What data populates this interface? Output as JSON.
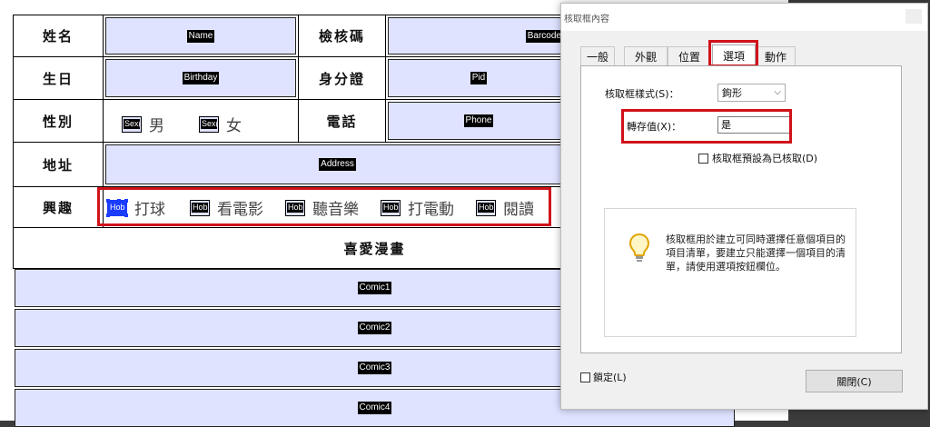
{
  "form": {
    "rows": [
      {
        "label": "姓名",
        "field": "Name",
        "label2": "檢核碼",
        "field2": "Barcode"
      },
      {
        "label": "生日",
        "field": "Birthday",
        "label2": "身分證",
        "field2": "Pid"
      },
      {
        "label": "性別",
        "label2": "電話",
        "field2": "Phone"
      },
      {
        "label": "地址",
        "field": "Address"
      },
      {
        "label": "興趣"
      }
    ],
    "sex_options": [
      {
        "tag": "Sex(",
        "text": "男"
      },
      {
        "tag": "Sex(",
        "text": "女"
      }
    ],
    "hobby_options": [
      {
        "tag": "Hob",
        "text": "打球"
      },
      {
        "tag": "Hob",
        "text": "看電影"
      },
      {
        "tag": "Hob",
        "text": "聽音樂"
      },
      {
        "tag": "Hob",
        "text": "打電動"
      },
      {
        "tag": "Hob",
        "text": "閱讀"
      }
    ],
    "comic_header": "喜愛漫畫",
    "comics": [
      "Comic1",
      "Comic2",
      "Comic3",
      "Comic4"
    ]
  },
  "dialog": {
    "title": "核取框內容",
    "tabs": [
      "一般",
      "外觀",
      "位置",
      "選項",
      "動作"
    ],
    "active_tab": "選項",
    "style_label": "核取框樣式(S)：",
    "style_value": "鉤形",
    "export_label": "轉存值(X)：",
    "export_value": "是",
    "default_checked_label": "核取框預設為已核取(D)",
    "info_text": "核取框用於建立可同時選擇任意個項目的項目清單，要建立只能選擇一個項目的清單，請使用選項按鈕欄位。",
    "lock_label": "鎖定(L)",
    "close_button": "關閉(C)"
  },
  "colors": {
    "field_bg": "#dfe3ff",
    "highlight": "#d0121b",
    "selection": "#1a3cff"
  }
}
